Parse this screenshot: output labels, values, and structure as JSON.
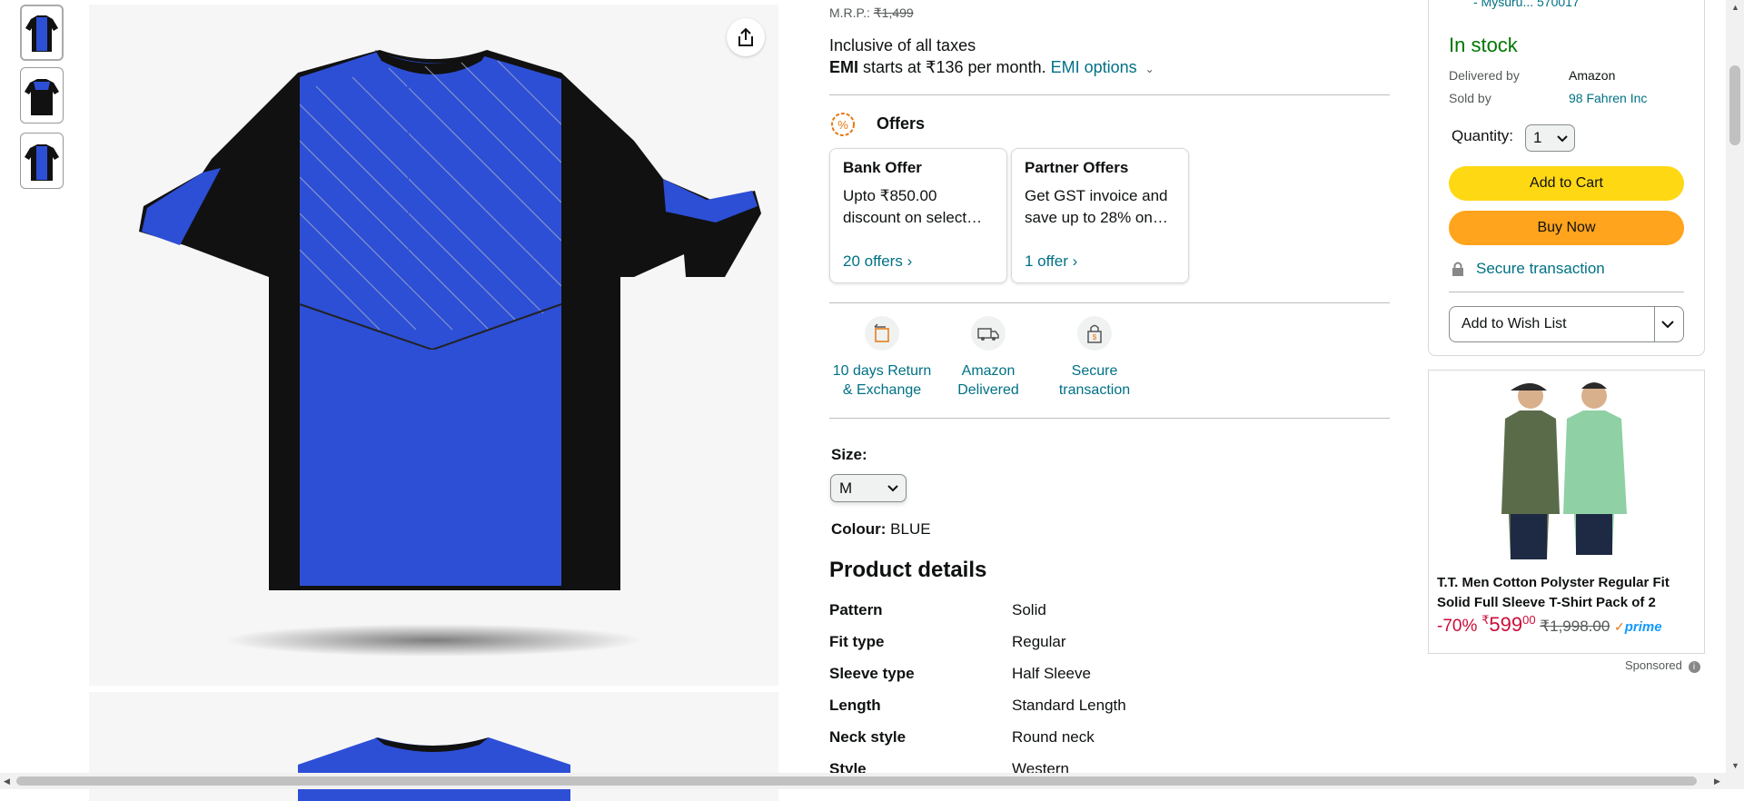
{
  "price": {
    "mrp_label": "M.R.P.:",
    "mrp_value": "₹1,499",
    "inclusive": "Inclusive of all taxes",
    "emi_bold": "EMI",
    "emi_text": "starts at ₹136 per month.",
    "emi_link": "EMI options"
  },
  "offers": {
    "title": "Offers",
    "cards": [
      {
        "title": "Bank Offer",
        "desc": "Upto ₹850.00 discount on select…",
        "link": "20 offers ›"
      },
      {
        "title": "Partner Offers",
        "desc": "Get GST invoice and save up to 28% on…",
        "link": "1 offer ›"
      }
    ]
  },
  "features": [
    {
      "icon": "return-box-icon",
      "line1": "10 days Return",
      "line2": "& Exchange"
    },
    {
      "icon": "delivery-truck-icon",
      "line1": "Amazon",
      "line2": "Delivered"
    },
    {
      "icon": "lock-icon",
      "line1": "Secure",
      "line2": "transaction"
    }
  ],
  "size": {
    "label": "Size:",
    "value": "M"
  },
  "colour": {
    "label": "Colour:",
    "value": "BLUE"
  },
  "product_details": {
    "title": "Product details",
    "rows": [
      {
        "k": "Pattern",
        "v": "Solid"
      },
      {
        "k": "Fit type",
        "v": "Regular"
      },
      {
        "k": "Sleeve type",
        "v": "Half Sleeve"
      },
      {
        "k": "Length",
        "v": "Standard Length"
      },
      {
        "k": "Neck style",
        "v": "Round neck"
      },
      {
        "k": "Style",
        "v": "Western"
      }
    ]
  },
  "buybox": {
    "address": "- Mysuru... 570017",
    "stock": "In stock",
    "delivered_by_label": "Delivered by",
    "delivered_by_value": "Amazon",
    "sold_by_label": "Sold by",
    "sold_by_value": "98 Fahren Inc",
    "quantity_label": "Quantity:",
    "quantity_value": "1",
    "add_to_cart": "Add to Cart",
    "buy_now": "Buy Now",
    "secure": "Secure transaction",
    "wishlist": "Add to Wish List"
  },
  "ad": {
    "title": "T.T. Men Cotton Polyster Regular Fit Solid Full Sleeve T-Shirt Pack of 2",
    "discount": "-70%",
    "price_symbol": "₹",
    "price_whole": "599",
    "price_fraction": "00",
    "list_price": "₹1,998.00",
    "prime": "prime",
    "sponsored": "Sponsored"
  },
  "colors": {
    "link": "#007185",
    "in_stock": "#007600",
    "add_to_cart": "#ffd814",
    "buy_now": "#ffa41c",
    "discount": "#cc0c39",
    "shirt_blue": "#2d4fd6"
  }
}
